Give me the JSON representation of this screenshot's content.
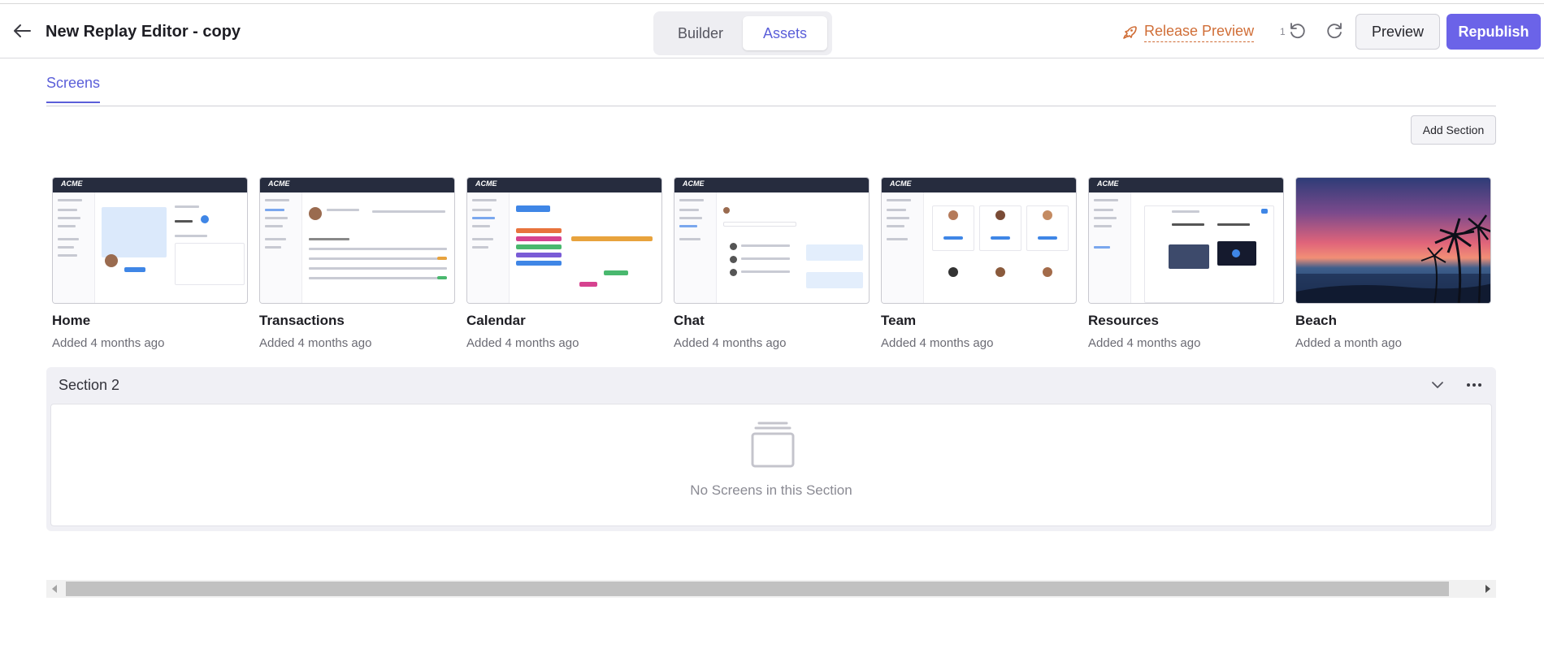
{
  "header": {
    "title": "New Replay Editor - copy",
    "tabs": [
      "Builder",
      "Assets"
    ],
    "active_tab": "Assets",
    "release_preview_label": "Release Preview",
    "undo_count": "1",
    "preview_label": "Preview",
    "republish_label": "Republish"
  },
  "tabs": {
    "screens_label": "Screens"
  },
  "add_section_label": "Add Section",
  "screens": [
    {
      "name": "Home",
      "added": "Added 4 months ago",
      "thumb_logo": "ACME"
    },
    {
      "name": "Transactions",
      "added": "Added 4 months ago",
      "thumb_logo": "ACME"
    },
    {
      "name": "Calendar",
      "added": "Added 4 months ago",
      "thumb_logo": "ACME"
    },
    {
      "name": "Chat",
      "added": "Added 4 months ago",
      "thumb_logo": "ACME"
    },
    {
      "name": "Team",
      "added": "Added 4 months ago",
      "thumb_logo": "ACME"
    },
    {
      "name": "Resources",
      "added": "Added 4 months ago",
      "thumb_logo": "ACME"
    },
    {
      "name": "Beach",
      "added": "Added a month ago"
    }
  ],
  "section2": {
    "title": "Section 2",
    "empty_text": "No Screens in this Section"
  },
  "colors": {
    "accent": "#5b5fd9",
    "republish_bg": "#6b63e8",
    "release_orange": "#d06e37",
    "thumb_header": "#262c3e"
  },
  "icons": [
    "back-arrow-icon",
    "rocket-icon",
    "undo-icon",
    "redo-icon",
    "chevron-down-icon",
    "more-horizontal-icon",
    "empty-screens-icon",
    "scroll-left-arrow",
    "scroll-right-arrow"
  ]
}
